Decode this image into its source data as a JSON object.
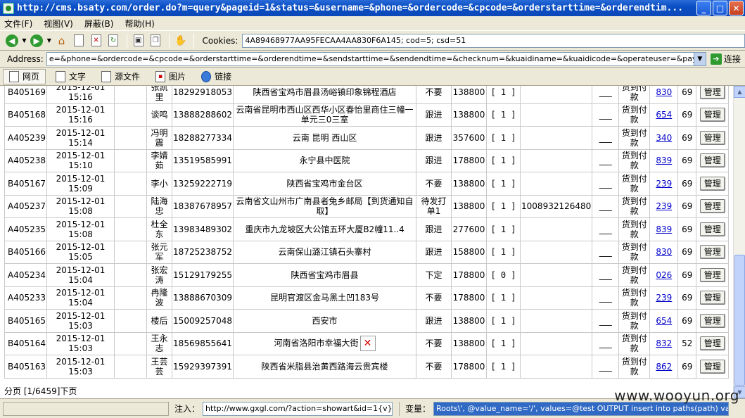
{
  "window": {
    "title": "http://cms.bsaty.com/order.do?m=query&pageid=1&status=&username=&phone=&ordercode=&cpcode=&orderstarttime=&orderendtim...",
    "min": "_",
    "max": "□",
    "close": "✕"
  },
  "menu": [
    "文件(F)",
    "视图(V)",
    "屏蔽(B)",
    "帮助(H)"
  ],
  "toolbar": {
    "cookies_label": "Cookies:",
    "cookies_value": "4A89468977AA95FECAA4AA830F6A145; cod=5; csd=51"
  },
  "address": {
    "label": "Address:",
    "value": "e=&phone=&ordercode=&cpcode=&orderstarttime=&orderendtime=&sendstarttime=&sendendtime=&checknum=&kuaidiname=&kuaidicode=&operateuser=&paytype=&kuaidistatus=&useraddress=",
    "go_label": "连接"
  },
  "viewtabs": [
    "网页",
    "文字",
    "源文件",
    "图片",
    "链接"
  ],
  "orders": [
    {
      "code": "B405169",
      "date": "2015-12-01",
      "time": "15:16",
      "name": "张凯里",
      "phone": "18292918053",
      "addr": "陕西省宝鸡市眉县汤峪镇印象锦程酒店",
      "status": "不要",
      "amount": "138800",
      "qty": "[ 1 ]",
      "kuaidi": "",
      "dash": "___",
      "pay": "货到付款",
      "link": "830",
      "num": "69",
      "btn": "管理"
    },
    {
      "code": "B405168",
      "date": "2015-12-01",
      "time": "15:16",
      "name": "谈鸣",
      "phone": "13888288602",
      "addr": "云南省昆明市西山区西华小区春怡里商住三幢一单元三0三室",
      "status": "跟进",
      "amount": "138800",
      "qty": "[ 1 ]",
      "kuaidi": "",
      "dash": "___",
      "pay": "货到付款",
      "link": "654",
      "num": "69",
      "btn": "管理"
    },
    {
      "code": "A405239",
      "date": "2015-12-01",
      "time": "15:14",
      "name": "冯明震",
      "phone": "18288277334",
      "addr": "云南 昆明 西山区",
      "status": "跟进",
      "amount": "357600",
      "qty": "[ 1 ]",
      "kuaidi": "",
      "dash": "___",
      "pay": "货到付款",
      "link": "340",
      "num": "69",
      "btn": "管理"
    },
    {
      "code": "A405238",
      "date": "2015-12-01",
      "time": "15:10",
      "name": "李婧茹",
      "phone": "13519585991",
      "addr": "永宁县中医院",
      "status": "跟进",
      "amount": "178800",
      "qty": "[ 1 ]",
      "kuaidi": "",
      "dash": "___",
      "pay": "货到付款",
      "link": "839",
      "num": "69",
      "btn": "管理"
    },
    {
      "code": "B405167",
      "date": "2015-12-01",
      "time": "15:09",
      "name": "李小",
      "phone": "13259222719",
      "addr": "陕西省宝鸡市金台区",
      "status": "不要",
      "amount": "138800",
      "qty": "[ 1 ]",
      "kuaidi": "",
      "dash": "___",
      "pay": "货到付款",
      "link": "239",
      "num": "69",
      "btn": "管理"
    },
    {
      "code": "A405237",
      "date": "2015-12-01",
      "time": "15:08",
      "name": "陆海忠",
      "phone": "18387678957",
      "addr": "云南省文山州市广南县者兔乡邮局【到货通知自取】",
      "status": "待发打单1",
      "amount": "138800",
      "qty": "[ 1 ]",
      "kuaidi": "1008932126480",
      "dash": "___",
      "pay": "货到付款",
      "link": "239",
      "num": "69",
      "btn": "管理"
    },
    {
      "code": "A405235",
      "date": "2015-12-01",
      "time": "15:08",
      "name": "杜全东",
      "phone": "13983489302",
      "addr": "重庆市九龙坡区大公馆五环大厦B2幢11..4",
      "status": "跟进",
      "amount": "277600",
      "qty": "[ 1 ]",
      "kuaidi": "",
      "dash": "___",
      "pay": "货到付款",
      "link": "839",
      "num": "69",
      "btn": "管理"
    },
    {
      "code": "B405166",
      "date": "2015-12-01",
      "time": "15:05",
      "name": "张元军",
      "phone": "18725238752",
      "addr": "云南保山潞江镇石头寨村",
      "status": "跟进",
      "amount": "158800",
      "qty": "[ 1 ]",
      "kuaidi": "",
      "dash": "___",
      "pay": "货到付款",
      "link": "830",
      "num": "69",
      "btn": "管理"
    },
    {
      "code": "A405234",
      "date": "2015-12-01",
      "time": "15:04",
      "name": "张宏涛",
      "phone": "15129179255",
      "addr": "陕西省宝鸡市眉县",
      "status": "下定",
      "amount": "178800",
      "qty": "[ 0 ]",
      "kuaidi": "",
      "dash": "___",
      "pay": "货到付款",
      "link": "026",
      "num": "69",
      "btn": "管理"
    },
    {
      "code": "A405233",
      "date": "2015-12-01",
      "time": "15:04",
      "name": "冉隆波",
      "phone": "13888670309",
      "addr": "昆明官渡区金马黑土凹183号",
      "status": "不要",
      "amount": "178800",
      "qty": "[ 1 ]",
      "kuaidi": "",
      "dash": "___",
      "pay": "货到付款",
      "link": "239",
      "num": "69",
      "btn": "管理"
    },
    {
      "code": "B405165",
      "date": "2015-12-01",
      "time": "15:03",
      "name": "楼后",
      "phone": "15009257048",
      "addr": "西安市",
      "status": "跟进",
      "amount": "138800",
      "qty": "[ 1 ]",
      "kuaidi": "",
      "dash": "___",
      "pay": "货到付款",
      "link": "654",
      "num": "69",
      "btn": "管理"
    },
    {
      "code": "B405164",
      "date": "2015-12-01",
      "time": "15:03",
      "name": "王永志",
      "phone": "18569855641",
      "addr": "河南省洛阳市幸福大街",
      "status": "不要",
      "amount": "138800",
      "qty": "[ 1 ]",
      "kuaidi": "",
      "dash": "___",
      "pay": "货到付款",
      "link": "832",
      "num": "52",
      "btn": "管理",
      "broken": true
    },
    {
      "code": "B405163",
      "date": "2015-12-01",
      "time": "15:03",
      "name": "王芸芸",
      "phone": "15929397391",
      "addr": "陕西省米脂县治黄西路海云贵宾楼",
      "status": "不要",
      "amount": "178800",
      "qty": "[ 1 ]",
      "kuaidi": "",
      "dash": "___",
      "pay": "货到付款",
      "link": "862",
      "num": "69",
      "btn": "管理"
    }
  ],
  "pager": "分页 [1/6459]下页",
  "statusbar": {
    "inject_label": "注入：",
    "inject_value": "http://www.gxgl.com/?action=showart&id=1{v}",
    "var_label": "变量：",
    "var_value": "Roots\\', @value_name='/', values=@test OUTPUT insert into paths(path) values(@test)--"
  },
  "watermark": "www.wooyun.org"
}
